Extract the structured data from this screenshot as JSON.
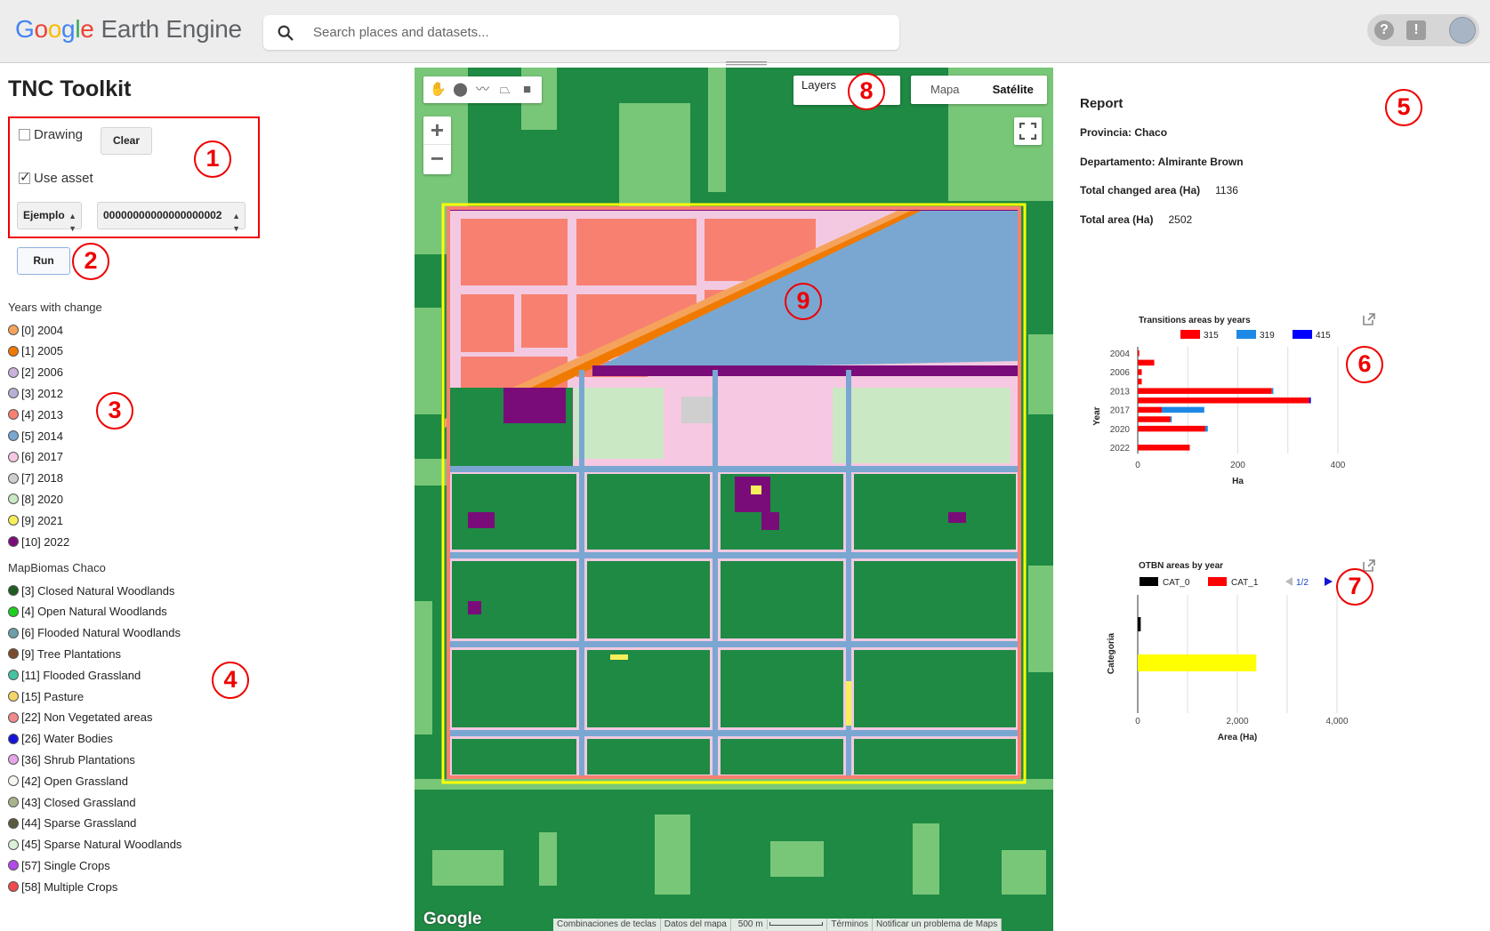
{
  "header": {
    "logo_google": "Google",
    "logo_product": "Earth Engine",
    "search_placeholder": "Search places and datasets...",
    "help_icon": "?",
    "feedback_icon": "!"
  },
  "left_panel": {
    "title": "TNC Toolkit",
    "drawing_label": "Drawing",
    "drawing_checked": false,
    "clear_label": "Clear",
    "use_asset_label": "Use asset",
    "use_asset_checked": true,
    "asset_select": "Ejemplo",
    "feature_select": "00000000000000000002",
    "run_label": "Run",
    "years_header": "Years with change",
    "years": [
      {
        "label": "[0] 2004",
        "color": "#f5a35c"
      },
      {
        "label": "[1] 2005",
        "color": "#f07a00"
      },
      {
        "label": "[2] 2006",
        "color": "#c9b3dd"
      },
      {
        "label": "[3] 2012",
        "color": "#b9b0d6"
      },
      {
        "label": "[4] 2013",
        "color": "#f88070"
      },
      {
        "label": "[5] 2014",
        "color": "#7aa7d1"
      },
      {
        "label": "[6] 2017",
        "color": "#f6c8e1"
      },
      {
        "label": "[7] 2018",
        "color": "#cfcfcf"
      },
      {
        "label": "[8] 2020",
        "color": "#cbe8c4"
      },
      {
        "label": "[9] 2021",
        "color": "#f7ef5a"
      },
      {
        "label": "[10] 2022",
        "color": "#7a0c7a"
      }
    ],
    "mapbiomas_header": "MapBiomas Chaco",
    "classes": [
      {
        "label": "[3] Closed Natural Woodlands",
        "color": "#1f5c1f"
      },
      {
        "label": "[4] Open Natural Woodlands",
        "color": "#1fd01f"
      },
      {
        "label": "[6] Flooded Natural Woodlands",
        "color": "#6aa0a6"
      },
      {
        "label": "[9] Tree Plantations",
        "color": "#7a4a2c"
      },
      {
        "label": "[11] Flooded Grassland",
        "color": "#46c2a2"
      },
      {
        "label": "[15] Pasture",
        "color": "#f5d56a"
      },
      {
        "label": "[22] Non Vegetated areas",
        "color": "#f08a8a"
      },
      {
        "label": "[26] Water Bodies",
        "color": "#1414d8"
      },
      {
        "label": "[36] Shrub Plantations",
        "color": "#e7a6e7"
      },
      {
        "label": "[42] Open Grassland",
        "color": "#f7f7f0"
      },
      {
        "label": "[43] Closed Grassland",
        "color": "#a7b58f"
      },
      {
        "label": "[44] Sparse Grassland",
        "color": "#5c5a3e"
      },
      {
        "label": "[45] Sparse Natural Woodlands",
        "color": "#d9f2d9"
      },
      {
        "label": "[57] Single Crops",
        "color": "#b24ae8"
      },
      {
        "label": "[58] Multiple Crops",
        "color": "#ef4b4b"
      }
    ]
  },
  "annotations": [
    "1",
    "2",
    "3",
    "4",
    "5",
    "6",
    "7",
    "8",
    "9"
  ],
  "map": {
    "layers_label": "Layers",
    "map_type_options": [
      "Mapa",
      "Satélite"
    ],
    "map_type_selected": "Satélite",
    "watermark": "Google",
    "footer": [
      "Combinaciones de teclas",
      "Datos del mapa",
      "500 m",
      "Términos",
      "Notificar un problema de Maps"
    ]
  },
  "report": {
    "title": "Report",
    "provincia_label": "Provincia: Chaco",
    "departamento_label": "Departamento: Almirante Brown",
    "total_changed_label": "Total changed area (Ha)",
    "total_changed_value": "1136",
    "total_area_label": "Total area (Ha)",
    "total_area_value": "2502"
  },
  "chart_data": [
    {
      "type": "bar",
      "orientation": "horizontal",
      "stacked": true,
      "title": "Transitions areas by years",
      "xlabel": "Ha",
      "ylabel": "Year",
      "xlim": [
        0,
        400
      ],
      "xticks": [
        "0",
        "200",
        "400"
      ],
      "grid": true,
      "legend_position": "top",
      "categories": [
        "2004",
        "2005",
        "2006",
        "2012",
        "2013",
        "2014",
        "2017",
        "2018",
        "2020",
        "2021",
        "2022"
      ],
      "ytick_labels": [
        "2004",
        "2006",
        "2013",
        "2017",
        "2020",
        "2022"
      ],
      "series": [
        {
          "name": "315",
          "color": "#ff0000",
          "values": [
            3,
            33,
            8,
            8,
            268,
            343,
            48,
            65,
            135,
            0,
            104
          ]
        },
        {
          "name": "319",
          "color": "#1e88e5",
          "values": [
            0,
            0,
            0,
            0,
            3,
            0,
            85,
            3,
            5,
            0,
            0
          ]
        },
        {
          "name": "415",
          "color": "#0000ff",
          "values": [
            0,
            0,
            0,
            0,
            0,
            3,
            0,
            0,
            0,
            0,
            0
          ]
        }
      ]
    },
    {
      "type": "bar",
      "orientation": "horizontal",
      "title": "OTBN areas by year",
      "xlabel": "Area (Ha)",
      "ylabel": "Categoria",
      "xlim": [
        0,
        4000
      ],
      "xticks": [
        "0",
        "2,000",
        "4,000"
      ],
      "grid": true,
      "legend_position": "top",
      "legend_page": "1/2",
      "series": [
        {
          "name": "CAT_0",
          "color": "#000000",
          "values": [
            60
          ]
        },
        {
          "name": "CAT_1",
          "color": "#ff0000",
          "values": [
            0
          ]
        }
      ],
      "extra_bar": {
        "color": "#ffff00",
        "value": 2380
      }
    }
  ]
}
